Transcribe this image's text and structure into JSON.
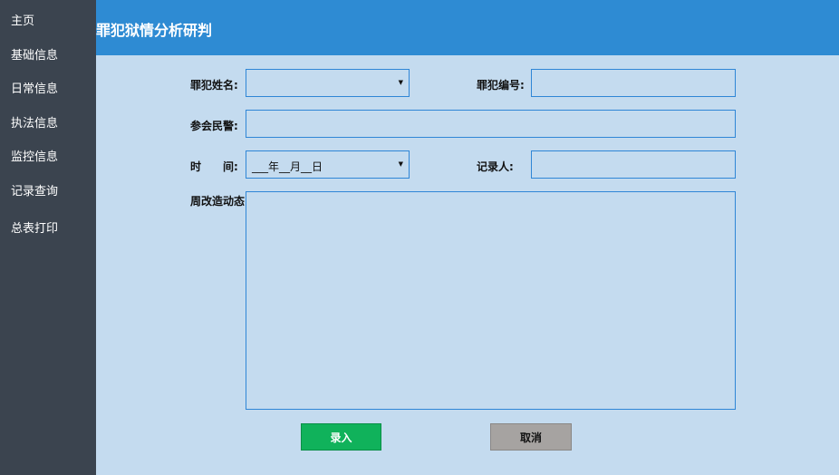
{
  "sidebar": {
    "items": [
      {
        "label": "主页"
      },
      {
        "label": "基础信息"
      },
      {
        "label": "日常信息"
      },
      {
        "label": "执法信息"
      },
      {
        "label": "监控信息"
      },
      {
        "label": "记录查询"
      },
      {
        "label": "总表打印"
      }
    ]
  },
  "header": {
    "title": "罪犯狱情分析研判"
  },
  "form": {
    "criminal_name": {
      "label": "罪犯姓名:",
      "value": ""
    },
    "criminal_number": {
      "label": "罪犯编号:",
      "value": ""
    },
    "officers": {
      "label": "参会民警:",
      "value": ""
    },
    "time": {
      "label": "时　　间:",
      "value": "___年__月__日"
    },
    "recorder": {
      "label": "记录人:",
      "value": ""
    },
    "weekly_dynamics": {
      "label": "周改造动态",
      "value": ""
    }
  },
  "buttons": {
    "submit": "录入",
    "cancel": "取消"
  },
  "icons": {
    "select_caret": "caret-down-icon"
  },
  "colors": {
    "sidebar_bg": "#3b444f",
    "header_bg": "#2e8bd3",
    "page_bg": "#c4dbef",
    "field_border": "#2f86d6",
    "submit_bg": "#10b25b",
    "cancel_bg": "#a6a3a1"
  }
}
